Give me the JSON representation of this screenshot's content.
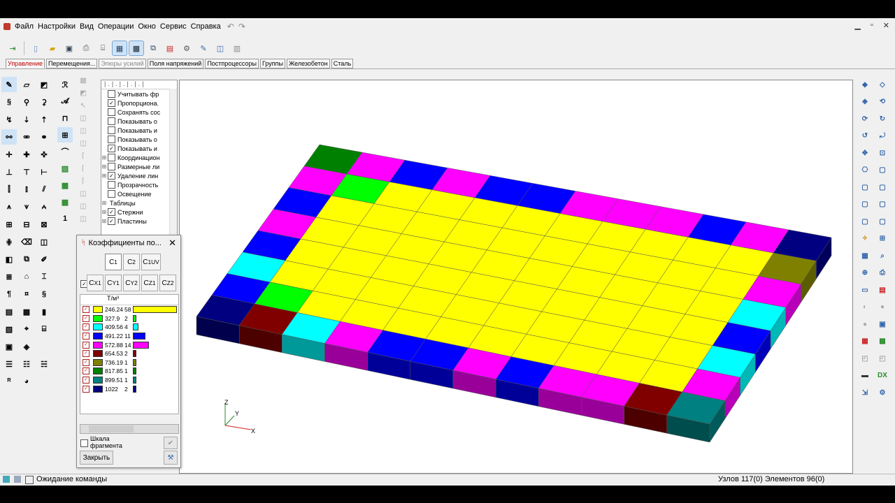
{
  "menu": {
    "items": [
      "Файл",
      "Настройки",
      "Вид",
      "Операции",
      "Окно",
      "Сервис",
      "Справка"
    ]
  },
  "toolbar": {
    "icons": [
      "import-icon",
      "new-file-icon",
      "open-folder-icon",
      "save-icon",
      "print-icon",
      "print-preview-icon",
      "grid-icon",
      "table-icon",
      "export-icon",
      "html-icon",
      "settings-icon",
      "tools-icon",
      "window-icon",
      "layers-icon"
    ]
  },
  "tabs": [
    {
      "label": "Управление",
      "active": true
    },
    {
      "label": "Перемещения...",
      "active": false
    },
    {
      "label": "Эпюры усилий",
      "active": false,
      "dim": true
    },
    {
      "label": "Поля напряжений",
      "active": false
    },
    {
      "label": "Постпроцессоры",
      "active": false
    },
    {
      "label": "Группы",
      "active": false
    },
    {
      "label": "Железобетон",
      "active": false
    },
    {
      "label": "Сталь",
      "active": false
    }
  ],
  "tree": {
    "rows": [
      {
        "label": "Учитывать фр",
        "checked": false,
        "exp": ""
      },
      {
        "label": "Пропорциона.",
        "checked": true,
        "exp": ""
      },
      {
        "label": "Сохранять сос",
        "checked": false,
        "exp": ""
      },
      {
        "label": "Показывать о",
        "checked": false,
        "exp": ""
      },
      {
        "label": "Показывать и",
        "checked": false,
        "exp": ""
      },
      {
        "label": "Показывать о",
        "checked": false,
        "exp": ""
      },
      {
        "label": "Показывать и",
        "checked": true,
        "exp": ""
      },
      {
        "label": "Координацион",
        "checked": false,
        "exp": "+"
      },
      {
        "label": "Размерные ли",
        "checked": false,
        "exp": "+"
      },
      {
        "label": "Удаление лин",
        "checked": true,
        "exp": "+"
      },
      {
        "label": "Прозрачность",
        "checked": false,
        "exp": ""
      },
      {
        "label": "Освещение",
        "checked": false,
        "exp": ""
      },
      {
        "label": "Таблицы",
        "checked": null,
        "exp": "+"
      },
      {
        "label": "Стержни",
        "checked": true,
        "exp": "+"
      },
      {
        "label": "Пластины",
        "checked": true,
        "exp": "+"
      }
    ]
  },
  "dialog": {
    "title": "Коэффициенты по...",
    "coef_buttons_row1": [
      "C1",
      "C2",
      "C1UV"
    ],
    "coef_buttons_row2": [
      "Cx1",
      "Cy1",
      "Cz1",
      "Cz1",
      "Cz2"
    ],
    "unit": "Т/м³",
    "legend": [
      {
        "value": "246.24",
        "count": "58",
        "color": "#ffff00",
        "bar": 0.95
      },
      {
        "value": "327.9",
        "count": "2",
        "color": "#00ff00",
        "bar": 0.05
      },
      {
        "value": "409.56",
        "count": "4",
        "color": "#00ffff",
        "bar": 0.1
      },
      {
        "value": "491.22",
        "count": "11",
        "color": "#0000ff",
        "bar": 0.25
      },
      {
        "value": "572.88",
        "count": "14",
        "color": "#ff00ff",
        "bar": 0.33
      },
      {
        "value": "654.53",
        "count": "2",
        "color": "#800000",
        "bar": 0.05
      },
      {
        "value": "736.19",
        "count": "1",
        "color": "#808000",
        "bar": 0.03
      },
      {
        "value": "817.85",
        "count": "1",
        "color": "#008000",
        "bar": 0.03
      },
      {
        "value": "899.51",
        "count": "1",
        "color": "#008080",
        "bar": 0.03
      },
      {
        "value": "1022",
        "count": "2",
        "color": "#000080",
        "bar": 0.05
      }
    ],
    "scale_label_1": "Шкала",
    "scale_label_2": "фрагмента",
    "close_label": "Закрыть"
  },
  "status": {
    "command": "Ожидание команды",
    "info": "Узлов 117(0) Элементов 96(0)"
  },
  "axes": {
    "z": "Z",
    "y": "Y",
    "x": "X"
  },
  "model": {
    "grid_cols": 12,
    "grid_rows": 8,
    "base_color": "#ffff00",
    "cells": [
      [
        "#008000",
        "#ff00ff",
        "#0000ff",
        "#ff00ff",
        "#0000ff",
        "#0000ff",
        "#ff00ff",
        "#ff00ff",
        "#ff00ff",
        "#0000ff",
        "#ff00ff",
        "#000080"
      ],
      [
        "#ff00ff",
        "#00ff00",
        "#ffff00",
        "#ffff00",
        "#ffff00",
        "#ffff00",
        "#ffff00",
        "#ffff00",
        "#ffff00",
        "#ffff00",
        "#ffff00",
        "#808000"
      ],
      [
        "#0000ff",
        "#ffff00",
        "#ffff00",
        "#ffff00",
        "#ffff00",
        "#ffff00",
        "#ffff00",
        "#ffff00",
        "#ffff00",
        "#ffff00",
        "#ffff00",
        "#ff00ff"
      ],
      [
        "#ff00ff",
        "#ffff00",
        "#ffff00",
        "#ffff00",
        "#ffff00",
        "#ffff00",
        "#ffff00",
        "#ffff00",
        "#ffff00",
        "#ffff00",
        "#ffff00",
        "#00ffff"
      ],
      [
        "#0000ff",
        "#ffff00",
        "#ffff00",
        "#ffff00",
        "#ffff00",
        "#ffff00",
        "#ffff00",
        "#ffff00",
        "#ffff00",
        "#ffff00",
        "#ffff00",
        "#0000ff"
      ],
      [
        "#00ffff",
        "#ffff00",
        "#ffff00",
        "#ffff00",
        "#ffff00",
        "#ffff00",
        "#ffff00",
        "#ffff00",
        "#ffff00",
        "#ffff00",
        "#ffff00",
        "#00ffff"
      ],
      [
        "#0000ff",
        "#00ff00",
        "#ffff00",
        "#ffff00",
        "#ffff00",
        "#ffff00",
        "#ffff00",
        "#ffff00",
        "#ffff00",
        "#ffff00",
        "#ffff00",
        "#ff00ff"
      ],
      [
        "#000080",
        "#800000",
        "#00ffff",
        "#ff00ff",
        "#0000ff",
        "#0000ff",
        "#ff00ff",
        "#0000ff",
        "#ff00ff",
        "#ff00ff",
        "#800000",
        "#008080"
      ]
    ]
  }
}
